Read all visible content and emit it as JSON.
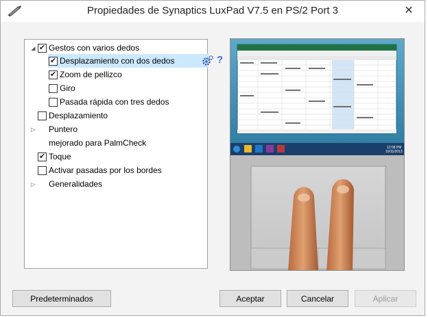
{
  "window": {
    "title": "Propiedades de Synaptics LuxPad V7.5 en PS/2 Port 3",
    "close_glyph": "✕"
  },
  "tree": [
    {
      "label": "Gestos con varios dedos",
      "checked": true,
      "expander": "open",
      "selected": false
    },
    {
      "label": "Desplazamiento con dos dedos",
      "checked": true,
      "selected": true
    },
    {
      "label": "Zoom de pellizco",
      "checked": true,
      "selected": false
    },
    {
      "label": "Giro",
      "checked": false,
      "selected": false
    },
    {
      "label": "Pasada rápida con tres dedos",
      "checked": false,
      "selected": false
    },
    {
      "label": "Desplazamiento",
      "checked": false,
      "selected": false
    },
    {
      "label": "Puntero",
      "expander": "closed",
      "selected": false
    },
    {
      "label": "mejorado para PalmCheck",
      "selected": false
    },
    {
      "label": "Toque",
      "checked": true,
      "selected": false
    },
    {
      "label": "Activar pasadas por los bordes",
      "checked": false,
      "selected": false
    },
    {
      "label": "Generalidades",
      "expander": "closed",
      "selected": false
    }
  ],
  "row_actions": {
    "settings_icon": "gear-icon",
    "help_glyph": "?"
  },
  "preview": {
    "taskbar_time": "12:08 PM",
    "taskbar_date": "10/11/2013"
  },
  "buttons": {
    "defaults": "Predeterminados",
    "accept": "Aceptar",
    "cancel": "Cancelar",
    "apply": "Aplicar"
  },
  "colors": {
    "selection": "#cce8ff",
    "window_bg": "#f3f3f3",
    "accent_help": "#3a6fd8"
  }
}
